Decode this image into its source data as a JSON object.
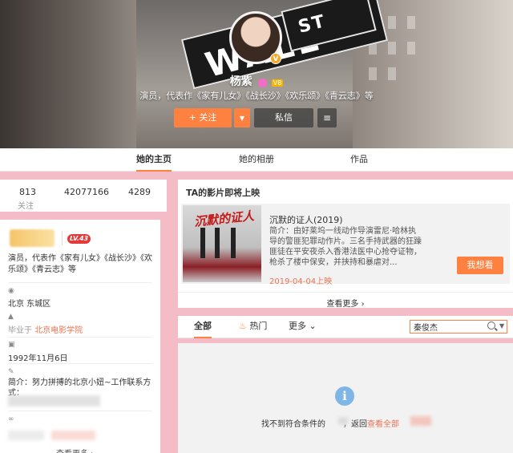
{
  "banner": {
    "sign_main": "WALL",
    "sign_street": "ST"
  },
  "profile_header": {
    "name": "杨紫",
    "vip_badge": "V8",
    "verified_badge": "V",
    "description": "演员，代表作《家有儿女》《战长沙》《欢乐颂》《青云志》等",
    "follow_label": "+ 关注",
    "message_label": "私信"
  },
  "tabs": [
    {
      "label": "她的主页",
      "active": true
    },
    {
      "label": "她的相册",
      "active": false
    },
    {
      "label": "作品",
      "active": false
    }
  ],
  "stats": {
    "follow_count": "813",
    "fans_count": "42077166",
    "weibo_count": "4289",
    "follow_label": "关注"
  },
  "profile": {
    "level": "LV.43",
    "description": "演员，代表作《家有儿女》《战长沙》《欢乐颂》《青云志》等",
    "location": "北京 东城区",
    "school_prefix": "毕业于",
    "school": "北京电影学院",
    "birthday": "1992年11月6日",
    "bio": "简介：努力拼搏的北京小妞~工作联系方式：",
    "more_label": "查看更多 ›"
  },
  "films": {
    "section_title": "TA的影片即将上映",
    "poster_title": "沉默的证人",
    "name": "沉默的证人(2019)",
    "description": "简介：由好莱坞一线动作导演雷尼·哈林执导的警匪犯罪动作片。三名手持武器的狂躁匪徒在平安夜杀入香港法医中心抢夺证物，枪杀了楼中保安，并挟持和暴虐对...",
    "date": "2019-04-04上映",
    "want_label": "我想看",
    "more_label": "查看更多 ›"
  },
  "filter": {
    "all_label": "全部",
    "hot_label": "热门",
    "more_label": "更多 ⌄",
    "search_value": "秦俊杰"
  },
  "empty": {
    "message_prefix": "找不到符合条件的",
    "message_middle": "，返回",
    "link_label": "查看全部"
  },
  "colors": {
    "accent": "#ff8140",
    "link": "#eb7350",
    "page_bg": "#f4bcc6"
  }
}
